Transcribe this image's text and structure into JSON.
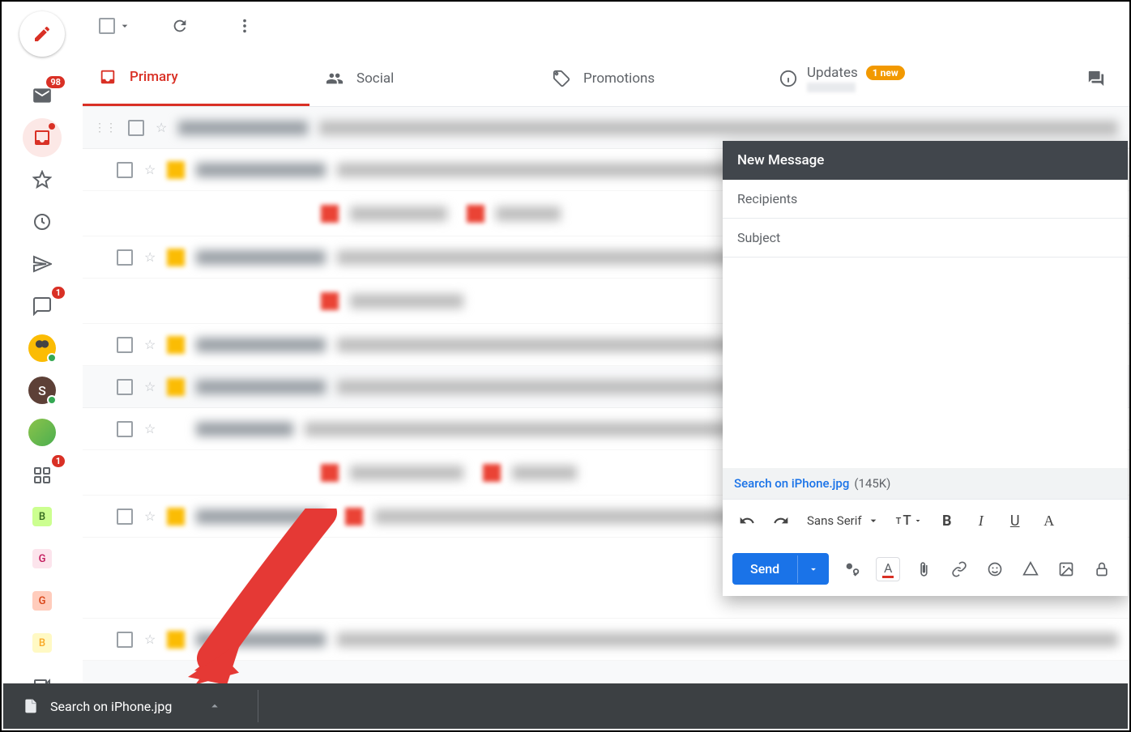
{
  "rail": {
    "inbox_badge": "98",
    "chat_badge": "1",
    "rooms_badge": "1",
    "avatar1_letter": "S",
    "label_letters": [
      "B",
      "G",
      "G",
      "B"
    ]
  },
  "tabs": {
    "primary": "Primary",
    "social": "Social",
    "promotions": "Promotions",
    "updates": "Updates",
    "updates_badge": "1 new"
  },
  "compose": {
    "title": "New Message",
    "recipients_placeholder": "Recipients",
    "subject_placeholder": "Subject",
    "attachment_name": "Search on iPhone.jpg",
    "attachment_size": "(145K)",
    "font_name": "Sans Serif",
    "send_label": "Send"
  },
  "download": {
    "filename": "Search on iPhone.jpg"
  }
}
